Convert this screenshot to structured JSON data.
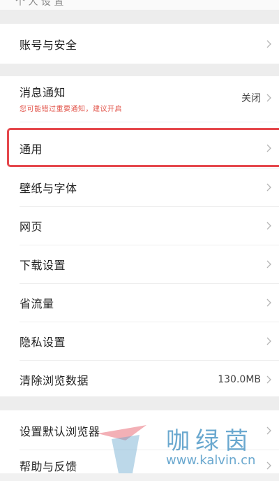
{
  "top_partial": "个 人 设 置",
  "menu": {
    "account_security": "账号与安全",
    "notifications": {
      "label": "消息通知",
      "hint": "您可能错过重要通知，建议开启",
      "value": "关闭"
    },
    "general": "通用",
    "wallpaper_font": "壁纸与字体",
    "webpage": "网页",
    "download_settings": "下载设置",
    "save_data": "省流量",
    "privacy_settings": "隐私设置",
    "clear_data": {
      "label": "清除浏览数据",
      "value": "130.0MB"
    },
    "default_browser": "设置默认浏览器",
    "help_feedback": "帮助与反馈"
  },
  "watermark": {
    "brand_cn": "咖绿茵",
    "url": "www.kalvin.cn"
  },
  "colors": {
    "highlight": "#e5484d",
    "hint_red": "#e2544a",
    "watermark_blue": "#6aa8cf"
  },
  "icons": [
    "chevron-right-icon"
  ]
}
